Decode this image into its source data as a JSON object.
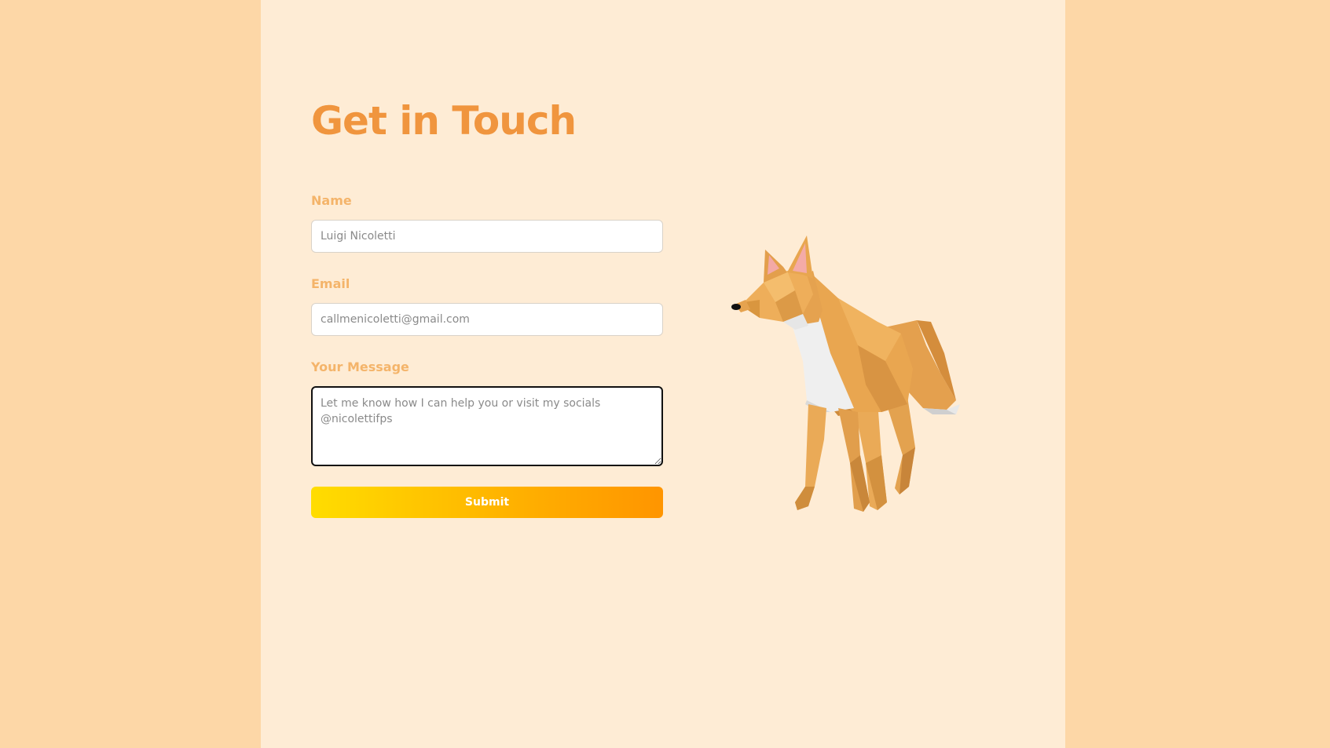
{
  "contact": {
    "title": "Get in Touch",
    "name_label": "Name",
    "name_placeholder": "Luigi Nicoletti",
    "email_label": "Email",
    "email_placeholder": "callmenicoletti@gmail.com",
    "message_label": "Your Message",
    "message_placeholder": "Let me know how I can help you or visit my socials @nicolettifps",
    "submit_label": "Submit"
  },
  "illustration": {
    "icon": "low-poly-fox-icon"
  },
  "colors": {
    "page_bg": "#fdd7a7",
    "panel_bg": "#feecd5",
    "title": "#f0953e",
    "label": "#f4b46a",
    "button_gradient_start": "#ffdd00",
    "button_gradient_end": "#ff9500"
  }
}
